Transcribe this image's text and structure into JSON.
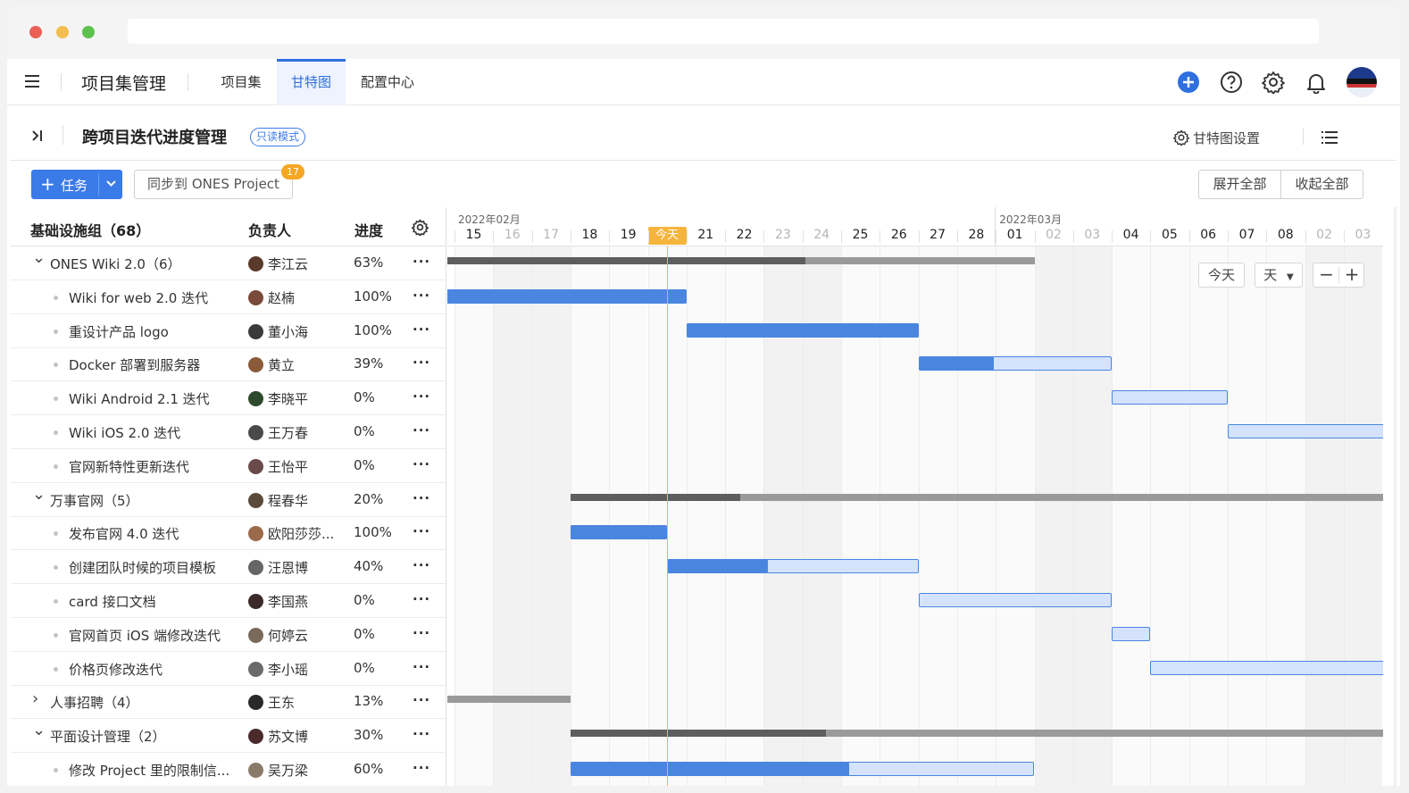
{
  "header": {
    "app_title": "项目集管理",
    "tabs": [
      {
        "label": "项目集"
      },
      {
        "label": "甘特图"
      },
      {
        "label": "配置中心"
      }
    ]
  },
  "sub": {
    "title": "跨项目迭代进度管理",
    "badge": "只读模式",
    "gantt_setting": "甘特图设置"
  },
  "toolbar": {
    "task_label": "任务",
    "sync_label": "同步到 ONES Project",
    "sync_count": "17",
    "expand_all": "展开全部",
    "collapse_all": "收起全部"
  },
  "table": {
    "group_header": "基础设施组（68）",
    "col_owner": "负责人",
    "col_progress": "进度",
    "rows": [
      {
        "name": "ONES Wiki 2.0（6）",
        "owner": "李江云",
        "progress": "63%",
        "level": 0,
        "expanded": true
      },
      {
        "name": "Wiki for web 2.0 迭代",
        "owner": "赵楠",
        "progress": "100%",
        "level": 1
      },
      {
        "name": "重设计产品 logo",
        "owner": "董小海",
        "progress": "100%",
        "level": 1
      },
      {
        "name": "Docker 部署到服务器",
        "owner": "黄立",
        "progress": "39%",
        "level": 1
      },
      {
        "name": "Wiki Android 2.1 迭代",
        "owner": "李晓平",
        "progress": "0%",
        "level": 1
      },
      {
        "name": "Wiki iOS 2.0 迭代",
        "owner": "王万春",
        "progress": "0%",
        "level": 1
      },
      {
        "name": "官网新特性更新迭代",
        "owner": "王怡平",
        "progress": "0%",
        "level": 1
      },
      {
        "name": "万事官网（5）",
        "owner": "程春华",
        "progress": "20%",
        "level": 0,
        "expanded": true
      },
      {
        "name": "发布官网 4.0 迭代",
        "owner": "欧阳莎莎...",
        "progress": "100%",
        "level": 1
      },
      {
        "name": "创建团队时候的项目模板",
        "owner": "汪恩博",
        "progress": "40%",
        "level": 1
      },
      {
        "name": "card 接口文档",
        "owner": "李国燕",
        "progress": "0%",
        "level": 1
      },
      {
        "name": "官网首页 iOS 端修改迭代",
        "owner": "何婷云",
        "progress": "0%",
        "level": 1
      },
      {
        "name": "价格页修改迭代",
        "owner": "李小瑶",
        "progress": "0%",
        "level": 1
      },
      {
        "name": "人事招聘（4）",
        "owner": "王东",
        "progress": "13%",
        "level": 0,
        "expanded": false
      },
      {
        "name": "平面设计管理（2）",
        "owner": "苏文博",
        "progress": "30%",
        "level": 0,
        "expanded": true
      },
      {
        "name": "修改 Project 里的限制信...",
        "owner": "吴万梁",
        "progress": "60%",
        "level": 1
      }
    ]
  },
  "timeline": {
    "months": [
      {
        "label": "2022年02月"
      },
      {
        "label": "2022年03月"
      }
    ],
    "today_label": "今天",
    "days": [
      {
        "label": "15",
        "weekend": false
      },
      {
        "label": "16",
        "weekend": true
      },
      {
        "label": "17",
        "weekend": true
      },
      {
        "label": "18",
        "weekend": false
      },
      {
        "label": "19",
        "weekend": false
      },
      {
        "label": "今天",
        "weekend": false,
        "today": true
      },
      {
        "label": "21",
        "weekend": false
      },
      {
        "label": "22",
        "weekend": false
      },
      {
        "label": "23",
        "weekend": true
      },
      {
        "label": "24",
        "weekend": true
      },
      {
        "label": "25",
        "weekend": false
      },
      {
        "label": "26",
        "weekend": false
      },
      {
        "label": "27",
        "weekend": false
      },
      {
        "label": "28",
        "weekend": false
      },
      {
        "label": "01",
        "weekend": false
      },
      {
        "label": "02",
        "weekend": true
      },
      {
        "label": "03",
        "weekend": true
      },
      {
        "label": "04",
        "weekend": false
      },
      {
        "label": "05",
        "weekend": false
      },
      {
        "label": "06",
        "weekend": false
      },
      {
        "label": "07",
        "weekend": false
      },
      {
        "label": "08",
        "weekend": false
      },
      {
        "label": "02",
        "weekend": true
      },
      {
        "label": "03",
        "weekend": true
      }
    ],
    "zoom_unit": "天"
  },
  "colors": {
    "accent": "#3b7be8",
    "bar_done": "#4a86e0",
    "bar_todo": "#d4e3fb",
    "summary": "#5e5e5e",
    "today": "#f5b43c"
  }
}
